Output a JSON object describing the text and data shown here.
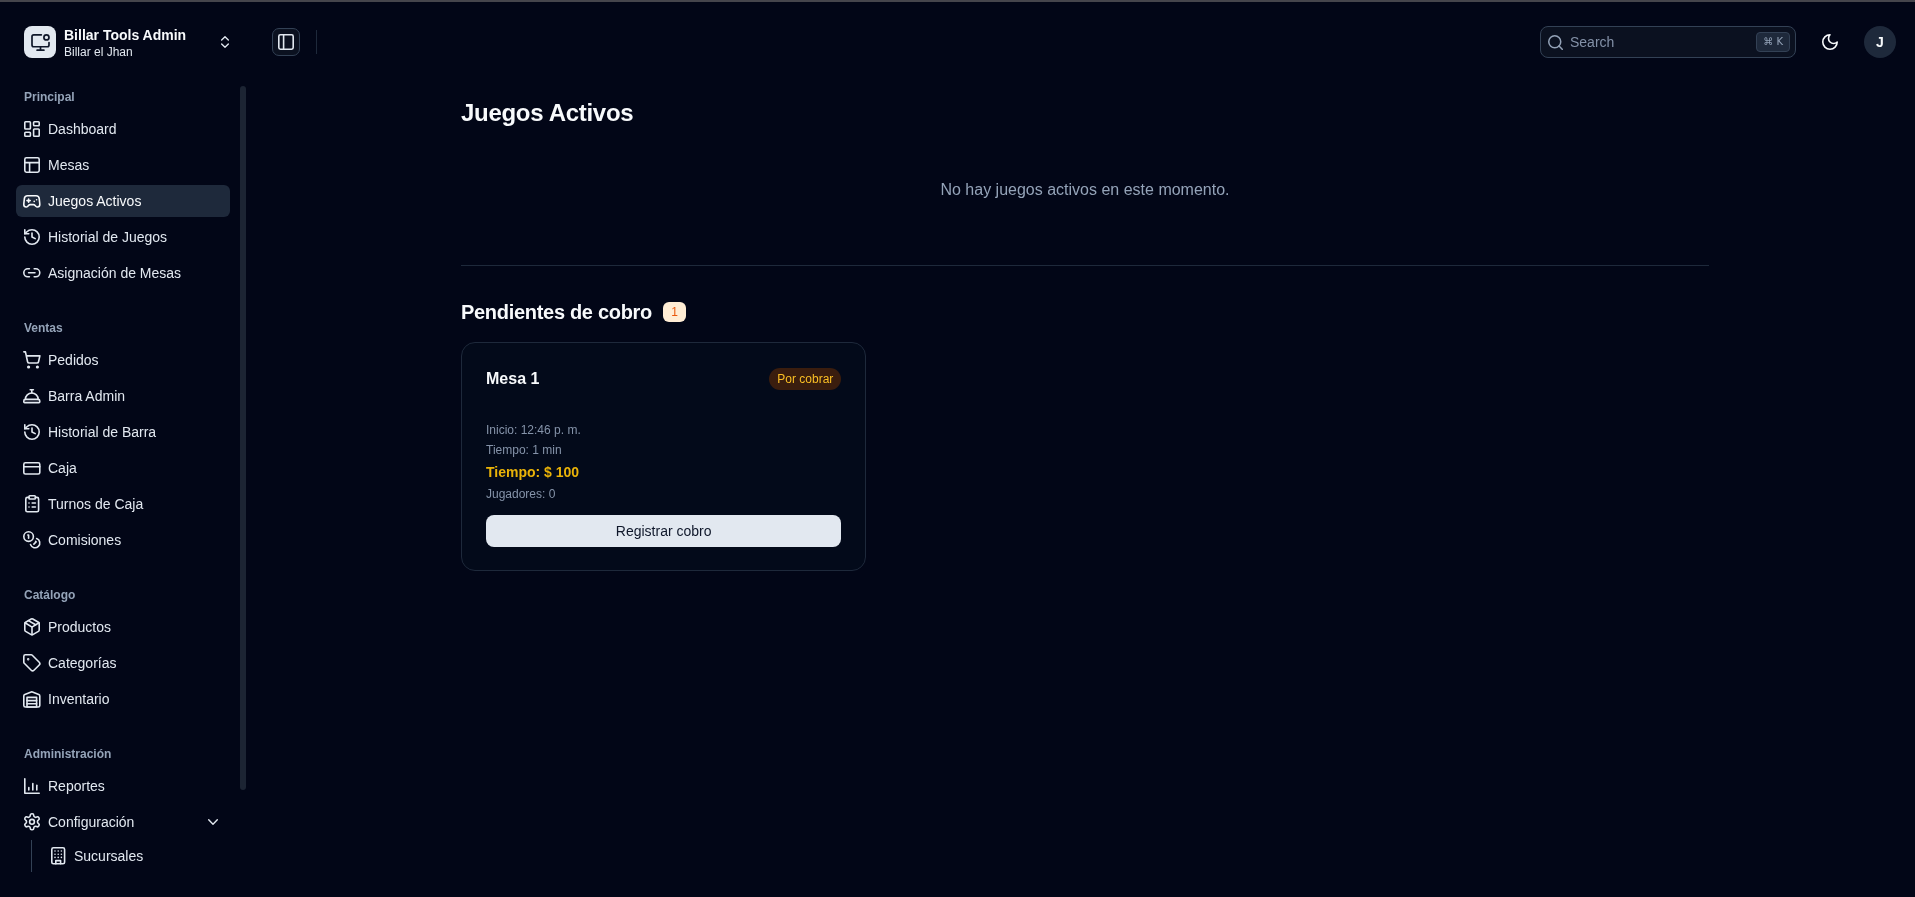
{
  "team": {
    "name": "Billar Tools Admin",
    "subtitle": "Billar el Jhan"
  },
  "sidebar": {
    "groups": [
      {
        "label": "Principal",
        "items": [
          {
            "label": "Dashboard",
            "selected": false
          },
          {
            "label": "Mesas",
            "selected": false
          },
          {
            "label": "Juegos Activos",
            "selected": true
          },
          {
            "label": "Historial de Juegos",
            "selected": false
          },
          {
            "label": "Asignación de Mesas",
            "selected": false
          }
        ]
      },
      {
        "label": "Ventas",
        "items": [
          {
            "label": "Pedidos",
            "selected": false
          },
          {
            "label": "Barra Admin",
            "selected": false
          },
          {
            "label": "Historial de Barra",
            "selected": false
          },
          {
            "label": "Caja",
            "selected": false
          },
          {
            "label": "Turnos de Caja",
            "selected": false
          },
          {
            "label": "Comisiones",
            "selected": false
          }
        ]
      },
      {
        "label": "Catálogo",
        "items": [
          {
            "label": "Productos",
            "selected": false
          },
          {
            "label": "Categorías",
            "selected": false
          },
          {
            "label": "Inventario",
            "selected": false
          }
        ]
      },
      {
        "label": "Administración",
        "items": [
          {
            "label": "Reportes",
            "selected": false
          },
          {
            "label": "Configuración",
            "selected": false,
            "expanded": true,
            "children": [
              {
                "label": "Sucursales",
                "selected": false
              }
            ]
          }
        ]
      }
    ]
  },
  "topbar": {
    "search": {
      "placeholder": "Search",
      "shortcut": "⌘ K"
    },
    "avatar": "J"
  },
  "page": {
    "title": "Juegos Activos",
    "empty_message": "No hay juegos activos en este momento."
  },
  "pending": {
    "title": "Pendientes de cobro",
    "count": "1",
    "cards": [
      {
        "title": "Mesa 1",
        "status": "Por cobrar",
        "lines": [
          {
            "kind": "info",
            "text": "Inicio: 12:46 p. m."
          },
          {
            "kind": "info",
            "text": "Tiempo: 1 min"
          },
          {
            "kind": "amount",
            "text": "Tiempo: $ 100"
          },
          {
            "kind": "info",
            "text": "Jugadores: 0"
          }
        ],
        "action": "Registrar cobro"
      }
    ]
  }
}
